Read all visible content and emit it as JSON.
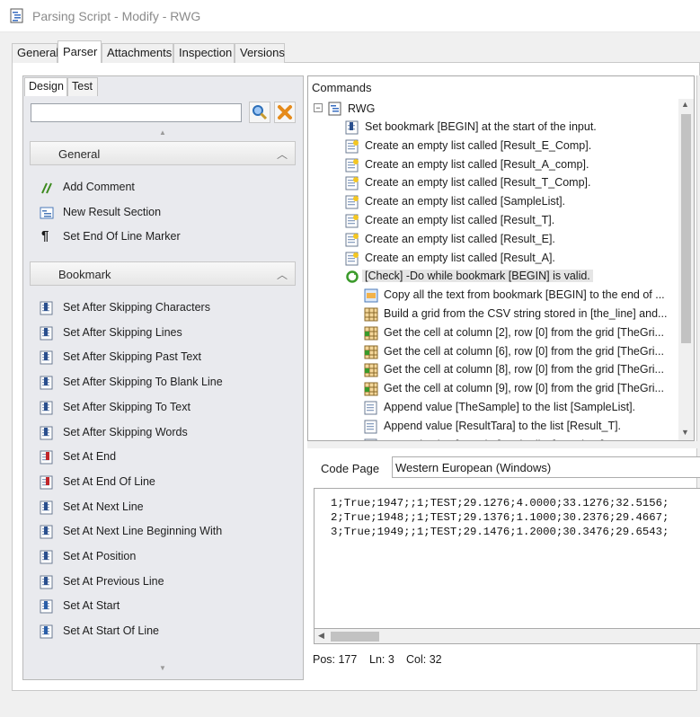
{
  "window": {
    "title": "Parsing Script - Modify - RWG"
  },
  "main_tabs": [
    {
      "label": "General"
    },
    {
      "label": "Parser"
    },
    {
      "label": "Attachments"
    },
    {
      "label": "Inspection"
    },
    {
      "label": "Versions"
    }
  ],
  "left": {
    "subtabs": [
      {
        "label": "Design"
      },
      {
        "label": "Test"
      }
    ],
    "search": {
      "value": "",
      "placeholder": ""
    },
    "groups": [
      {
        "title": "General",
        "items": [
          {
            "label": "Add Comment",
            "icon": "comment-icon"
          },
          {
            "label": "New Result Section",
            "icon": "result-section-icon"
          },
          {
            "label": "Set End Of Line Marker",
            "icon": "pilcrow-icon"
          }
        ]
      },
      {
        "title": "Bookmark",
        "items": [
          {
            "label": "Set After Skipping Characters"
          },
          {
            "label": "Set After Skipping Lines"
          },
          {
            "label": "Set After Skipping Past Text"
          },
          {
            "label": "Set After Skipping To Blank Line"
          },
          {
            "label": "Set After Skipping To Text"
          },
          {
            "label": "Set After Skipping Words"
          },
          {
            "label": "Set At End"
          },
          {
            "label": "Set At End Of Line"
          },
          {
            "label": "Set At Next Line"
          },
          {
            "label": "Set At Next Line Beginning With"
          },
          {
            "label": "Set At Position"
          },
          {
            "label": "Set At Previous Line"
          },
          {
            "label": "Set At Start"
          },
          {
            "label": "Set At Start Of Line"
          }
        ]
      }
    ]
  },
  "commands": {
    "header": "Commands",
    "root": "RWG",
    "rows": [
      {
        "text": "Set bookmark [BEGIN] at the start of the input.",
        "icon": "bookmark-icon"
      },
      {
        "text": "Create an empty list called [Result_E_Comp].",
        "icon": "list-icon"
      },
      {
        "text": "Create an empty list called [Result_A_comp].",
        "icon": "list-icon"
      },
      {
        "text": "Create an empty list called [Result_T_Comp].",
        "icon": "list-icon"
      },
      {
        "text": "Create an empty list called [SampleList].",
        "icon": "list-icon"
      },
      {
        "text": "Create an empty list called [Result_T].",
        "icon": "list-icon"
      },
      {
        "text": "Create an empty list called [Result_E].",
        "icon": "list-icon"
      },
      {
        "text": "Create an empty list called [Result_A].",
        "icon": "list-icon"
      },
      {
        "text": "[Check] -Do while bookmark [BEGIN] is valid.",
        "icon": "loop-icon"
      },
      {
        "text": "Copy all the text from bookmark [BEGIN] to the end of ...",
        "icon": "copy-text-icon"
      },
      {
        "text": "Build a grid from the CSV string stored in [the_line] and...",
        "icon": "grid-icon"
      },
      {
        "text": "Get the cell at column [2], row [0] from the grid [TheGri...",
        "icon": "grid-cell-icon"
      },
      {
        "text": "Get the cell at column [6], row [0] from the grid [TheGri...",
        "icon": "grid-cell-icon"
      },
      {
        "text": "Get the cell at column [8], row [0] from the grid [TheGri...",
        "icon": "grid-cell-icon"
      },
      {
        "text": "Get the cell at column [9], row [0] from the grid [TheGri...",
        "icon": "grid-cell-icon"
      },
      {
        "text": "Append value [TheSample] to the list [SampleList].",
        "icon": "append-icon"
      },
      {
        "text": "Append value [ResultTara] to the list [Result_T].",
        "icon": "append-icon"
      },
      {
        "text": "Append value [ResultE] to the list [Result_E].",
        "icon": "append-icon"
      }
    ]
  },
  "code_page": {
    "label": "Code Page",
    "value": "Western European (Windows)"
  },
  "test_text": [
    "1;True;1947;;1;TEST;29.1276;4.0000;33.1276;32.5156;",
    "2;True;1948;;1;TEST;29.1376;1.1000;30.2376;29.4667;",
    "3;True;1949;;1;TEST;29.1476;1.2000;30.3476;29.6543;"
  ],
  "status": {
    "pos": "Pos: 177",
    "ln": "Ln: 3",
    "col": "Col: 32"
  }
}
